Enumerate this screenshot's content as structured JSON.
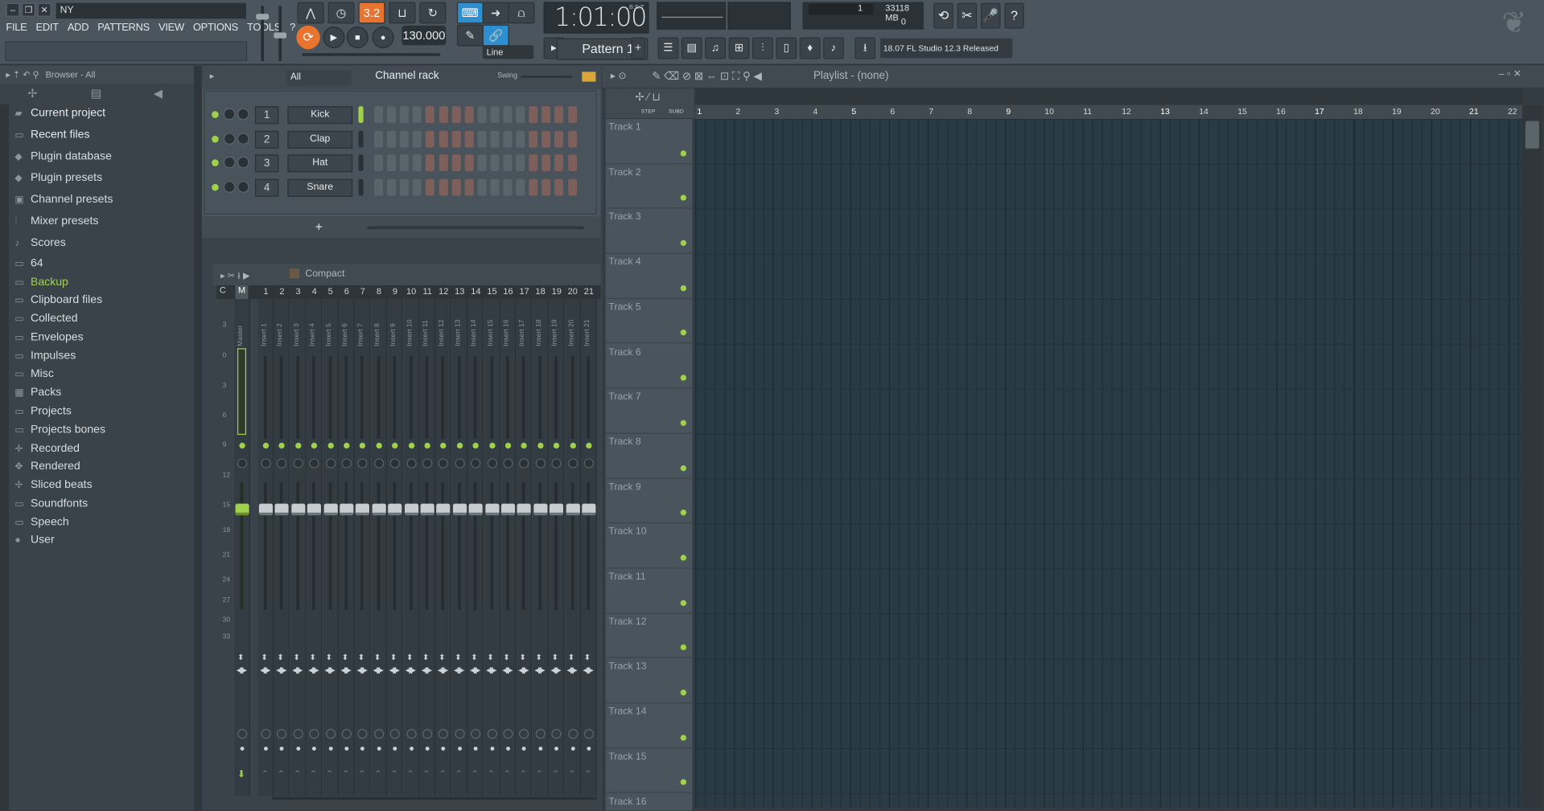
{
  "window": {
    "project_name": "NY",
    "min": "–",
    "restore": "❐",
    "close": "✕"
  },
  "menu": [
    "FILE",
    "EDIT",
    "ADD",
    "PATTERNS",
    "VIEW",
    "OPTIONS",
    "TOOLS",
    "?"
  ],
  "transport": {
    "time": "1:01:00",
    "time_unit": "B:S:T",
    "tempo": "130.000",
    "pattern": "Pattern 1",
    "snap": "Line",
    "step_mode": "3.2"
  },
  "monitor": {
    "cpu_value": "1",
    "memory": "33118 MB",
    "polyphony": "0"
  },
  "news": {
    "text": "18.07  FL Studio 12.3 Released"
  },
  "browser": {
    "header": "Browser - All",
    "items": [
      {
        "label": "Current project",
        "icon": "project-icon"
      },
      {
        "label": "Recent files",
        "icon": "folder-icon"
      },
      {
        "label": "Plugin database",
        "icon": "plugin-icon"
      },
      {
        "label": "Plugin presets",
        "icon": "plugin-icon"
      },
      {
        "label": "Channel presets",
        "icon": "channel-icon"
      },
      {
        "label": "Mixer presets",
        "icon": "mixer-icon"
      },
      {
        "label": "Scores",
        "icon": "note-icon"
      },
      {
        "label": "64",
        "icon": "folder-icon"
      },
      {
        "label": "Backup",
        "icon": "folder-icon"
      },
      {
        "label": "Clipboard files",
        "icon": "folder-icon"
      },
      {
        "label": "Collected",
        "icon": "folder-icon"
      },
      {
        "label": "Envelopes",
        "icon": "folder-icon"
      },
      {
        "label": "Impulses",
        "icon": "folder-icon"
      },
      {
        "label": "Misc",
        "icon": "folder-icon"
      },
      {
        "label": "Packs",
        "icon": "packs-icon"
      },
      {
        "label": "Projects",
        "icon": "folder-icon"
      },
      {
        "label": "Projects bones",
        "icon": "folder-icon"
      },
      {
        "label": "Recorded",
        "icon": "record-icon"
      },
      {
        "label": "Rendered",
        "icon": "render-icon"
      },
      {
        "label": "Sliced beats",
        "icon": "slice-icon"
      },
      {
        "label": "Soundfonts",
        "icon": "folder-icon"
      },
      {
        "label": "Speech",
        "icon": "folder-icon"
      },
      {
        "label": "User",
        "icon": "user-icon"
      }
    ]
  },
  "channel_rack": {
    "filter": "All",
    "title": "Channel rack",
    "swing_label": "Swing",
    "channels": [
      {
        "num": "1",
        "name": "Kick"
      },
      {
        "num": "2",
        "name": "Clap"
      },
      {
        "num": "3",
        "name": "Hat"
      },
      {
        "num": "4",
        "name": "Snare"
      }
    ],
    "add_label": "+"
  },
  "mixer": {
    "preset": "Compact",
    "c_label": "C",
    "m_label": "M",
    "master_name": "Master",
    "inserts": [
      "Insert 1",
      "Insert 2",
      "Insert 3",
      "Insert 4",
      "Insert 5",
      "Insert 6",
      "Insert 7",
      "Insert 8",
      "Insert 9",
      "Insert 10",
      "Insert 11",
      "Insert 12",
      "Insert 13",
      "Insert 14",
      "Insert 15",
      "Insert 16",
      "Insert 17",
      "Insert 18",
      "Insert 19",
      "Insert 20",
      "Insert 21"
    ],
    "insert_numbers": [
      "1",
      "2",
      "3",
      "4",
      "5",
      "6",
      "7",
      "8",
      "9",
      "10",
      "11",
      "12",
      "13",
      "14",
      "15",
      "16",
      "17",
      "18",
      "19",
      "20",
      "21"
    ],
    "db_scale": [
      "3",
      "0",
      "3",
      "6",
      "9",
      "12",
      "15",
      "18",
      "21",
      "24",
      "27",
      "30",
      "33"
    ]
  },
  "playlist": {
    "title": "Playlist - (none)",
    "step_label": "STEP",
    "sub_label": "SUBD",
    "bars": [
      "1",
      "2",
      "3",
      "4",
      "5",
      "6",
      "7",
      "8",
      "9",
      "10",
      "11",
      "12",
      "13",
      "14",
      "15",
      "16",
      "17",
      "18",
      "19",
      "20",
      "21",
      "22"
    ],
    "tracks": [
      "Track 1",
      "Track 2",
      "Track 3",
      "Track 4",
      "Track 5",
      "Track 6",
      "Track 7",
      "Track 8",
      "Track 9",
      "Track 10",
      "Track 11",
      "Track 12",
      "Track 13",
      "Track 14",
      "Track 15",
      "Track 16"
    ]
  }
}
